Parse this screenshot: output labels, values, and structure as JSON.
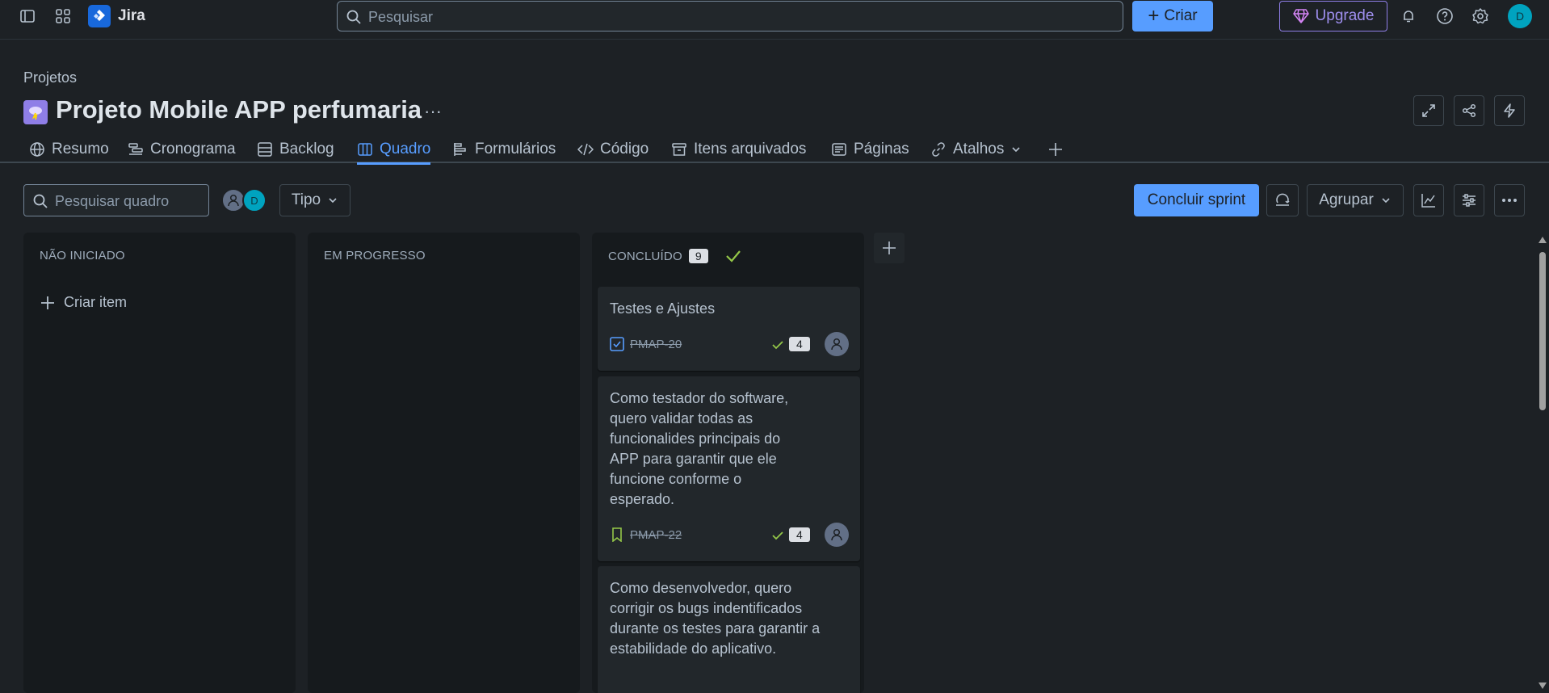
{
  "topnav": {
    "app_name": "Jira",
    "search_placeholder": "Pesquisar",
    "create_label": "Criar",
    "upgrade_label": "Upgrade",
    "avatar_initial": "D"
  },
  "header": {
    "breadcrumb": "Projetos",
    "title": "Projeto Mobile APP perfumaria",
    "more": "···"
  },
  "tabs": [
    {
      "label": "Resumo",
      "icon": "globe-icon"
    },
    {
      "label": "Cronograma",
      "icon": "timeline-icon"
    },
    {
      "label": "Backlog",
      "icon": "backlog-icon"
    },
    {
      "label": "Quadro",
      "icon": "board-icon",
      "active": true
    },
    {
      "label": "Formulários",
      "icon": "forms-icon"
    },
    {
      "label": "Código",
      "icon": "code-icon"
    },
    {
      "label": "Itens arquivados",
      "icon": "archive-icon"
    },
    {
      "label": "Páginas",
      "icon": "pages-icon"
    },
    {
      "label": "Atalhos",
      "icon": "link-icon"
    }
  ],
  "toolbar": {
    "search_placeholder": "Pesquisar quadro",
    "avatar_initial": "D",
    "type_filter": "Tipo",
    "complete_sprint": "Concluir sprint",
    "group_by": "Agrupar"
  },
  "columns": [
    {
      "title": "NÃO INICIADO",
      "create_label": "Criar item"
    },
    {
      "title": "EM PROGRESSO"
    },
    {
      "title": "CONCLUÍDO",
      "count": "9"
    }
  ],
  "cards": [
    {
      "summary": "Testes e Ajustes",
      "key": "PMAP-20",
      "type": "task",
      "estimate": "4"
    },
    {
      "summary": "Como testador do software, quero validar todas as funcionalides principais do APP para garantir que ele funcione conforme o esperado.",
      "key": "PMAP-22",
      "type": "story",
      "estimate": "4"
    },
    {
      "summary": "Como desenvolvedor, quero corrigir os bugs indentificados durante os testes para garantir a estabilidade do aplicativo."
    }
  ],
  "colors": {
    "background": "#1d2125",
    "column": "#161a1d",
    "card": "#22272b",
    "accent": "#579dff",
    "upgrade": "#9f8fef",
    "done_check": "#94c748"
  }
}
